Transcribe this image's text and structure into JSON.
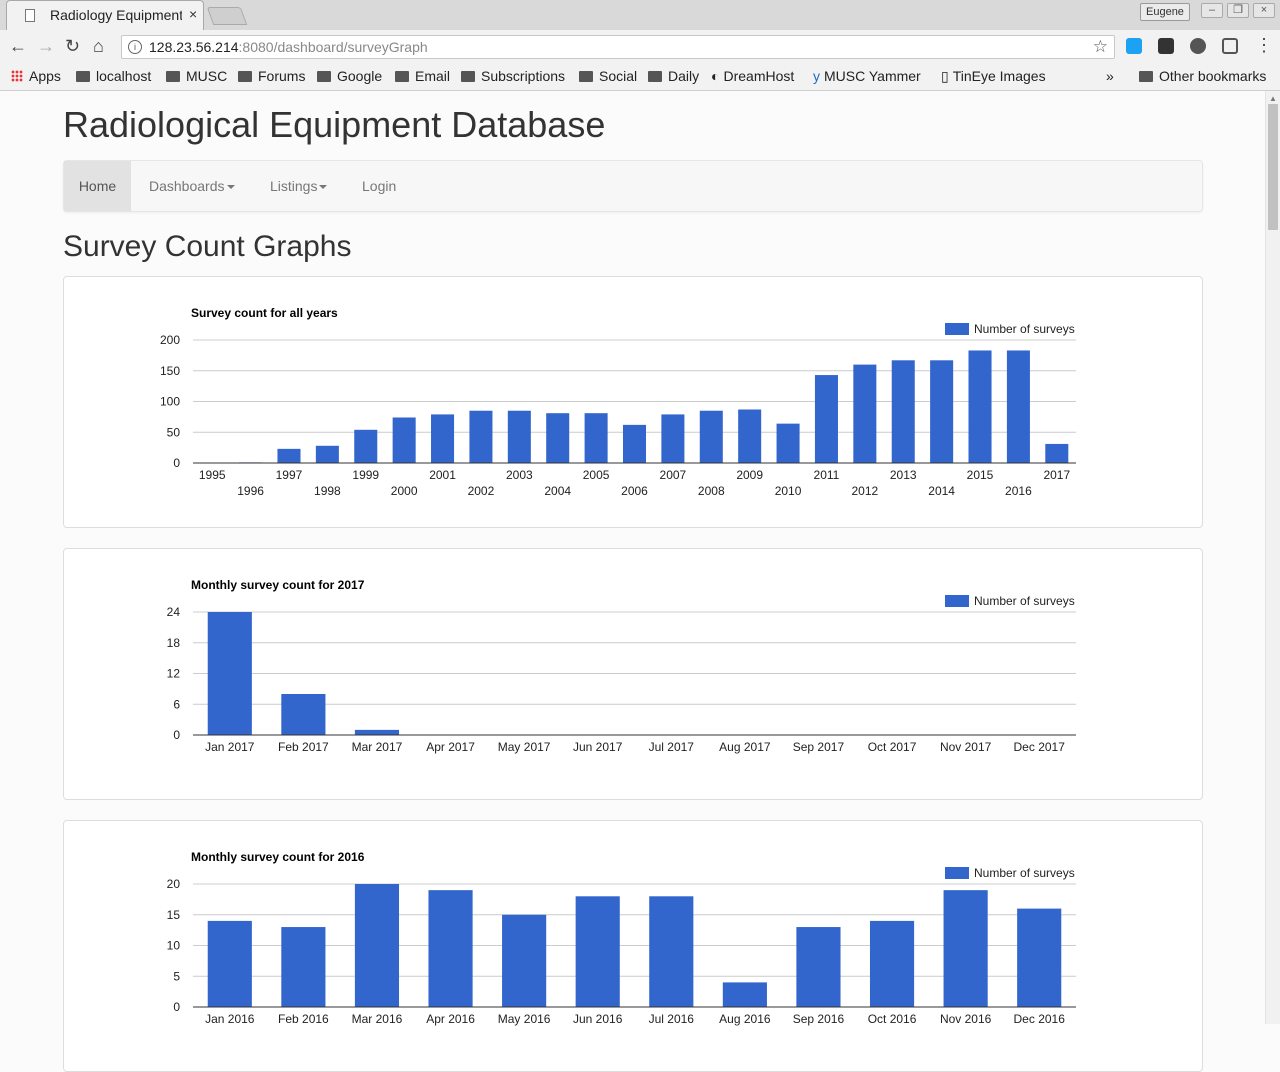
{
  "browser": {
    "tab_title": "Radiology Equipment",
    "tab_close": "×",
    "profile_name": "Eugene",
    "url_host": "128.23.56.214",
    "url_path": ":8080/dashboard/surveyGraph",
    "bookmarks": [
      "Apps",
      "localhost",
      "MUSC",
      "Forums",
      "Google",
      "Email",
      "Subscriptions",
      "Social",
      "Daily",
      "DreamHost",
      "MUSC Yammer",
      "TinEye Images"
    ],
    "bookmarks_overflow": "»",
    "other_bookmarks": "Other bookmarks"
  },
  "page": {
    "site_title": "Radiological Equipment Database",
    "nav": {
      "home": "Home",
      "dashboards": "Dashboards",
      "listings": "Listings",
      "login": "Login"
    },
    "heading": "Survey Count Graphs"
  },
  "colors": {
    "bar": "#3366cc",
    "grid": "#cccccc",
    "axis": "#333333"
  },
  "chart_data": [
    {
      "type": "bar",
      "title": "Survey count for all years",
      "series": [
        {
          "name": "Number of surveys",
          "values": [
            0,
            1,
            23,
            28,
            54,
            74,
            79,
            85,
            85,
            81,
            81,
            62,
            79,
            85,
            87,
            64,
            143,
            160,
            167,
            167,
            183,
            183,
            31
          ]
        }
      ],
      "categories": [
        "1995",
        "1996",
        "1997",
        "1998",
        "1999",
        "2000",
        "2001",
        "2002",
        "2003",
        "2004",
        "2005",
        "2006",
        "2007",
        "2008",
        "2009",
        "2010",
        "2011",
        "2012",
        "2013",
        "2014",
        "2015",
        "2016",
        "2017"
      ],
      "yticks": [
        0,
        50,
        100,
        150,
        200
      ],
      "ylim": [
        0,
        200
      ],
      "staggered_labels": true,
      "legend": "top-right"
    },
    {
      "type": "bar",
      "title": "Monthly survey count for 2017",
      "series": [
        {
          "name": "Number of surveys",
          "values": [
            24,
            8,
            1,
            0,
            0,
            0,
            0,
            0,
            0,
            0,
            0,
            0
          ]
        }
      ],
      "categories": [
        "Jan 2017",
        "Feb 2017",
        "Mar 2017",
        "Apr 2017",
        "May 2017",
        "Jun 2017",
        "Jul 2017",
        "Aug 2017",
        "Sep 2017",
        "Oct 2017",
        "Nov 2017",
        "Dec 2017"
      ],
      "yticks": [
        0,
        6,
        12,
        18,
        24
      ],
      "ylim": [
        0,
        24
      ],
      "staggered_labels": false,
      "legend": "top-right"
    },
    {
      "type": "bar",
      "title": "Monthly survey count for 2016",
      "series": [
        {
          "name": "Number of surveys",
          "values": [
            14,
            13,
            20,
            19,
            15,
            18,
            18,
            4,
            13,
            14,
            19,
            16
          ]
        }
      ],
      "categories": [
        "Jan 2016",
        "Feb 2016",
        "Mar 2016",
        "Apr 2016",
        "May 2016",
        "Jun 2016",
        "Jul 2016",
        "Aug 2016",
        "Sep 2016",
        "Oct 2016",
        "Nov 2016",
        "Dec 2016"
      ],
      "yticks": [
        0,
        5,
        10,
        15,
        20
      ],
      "ylim": [
        0,
        20
      ],
      "staggered_labels": false,
      "legend": "top-right"
    }
  ]
}
